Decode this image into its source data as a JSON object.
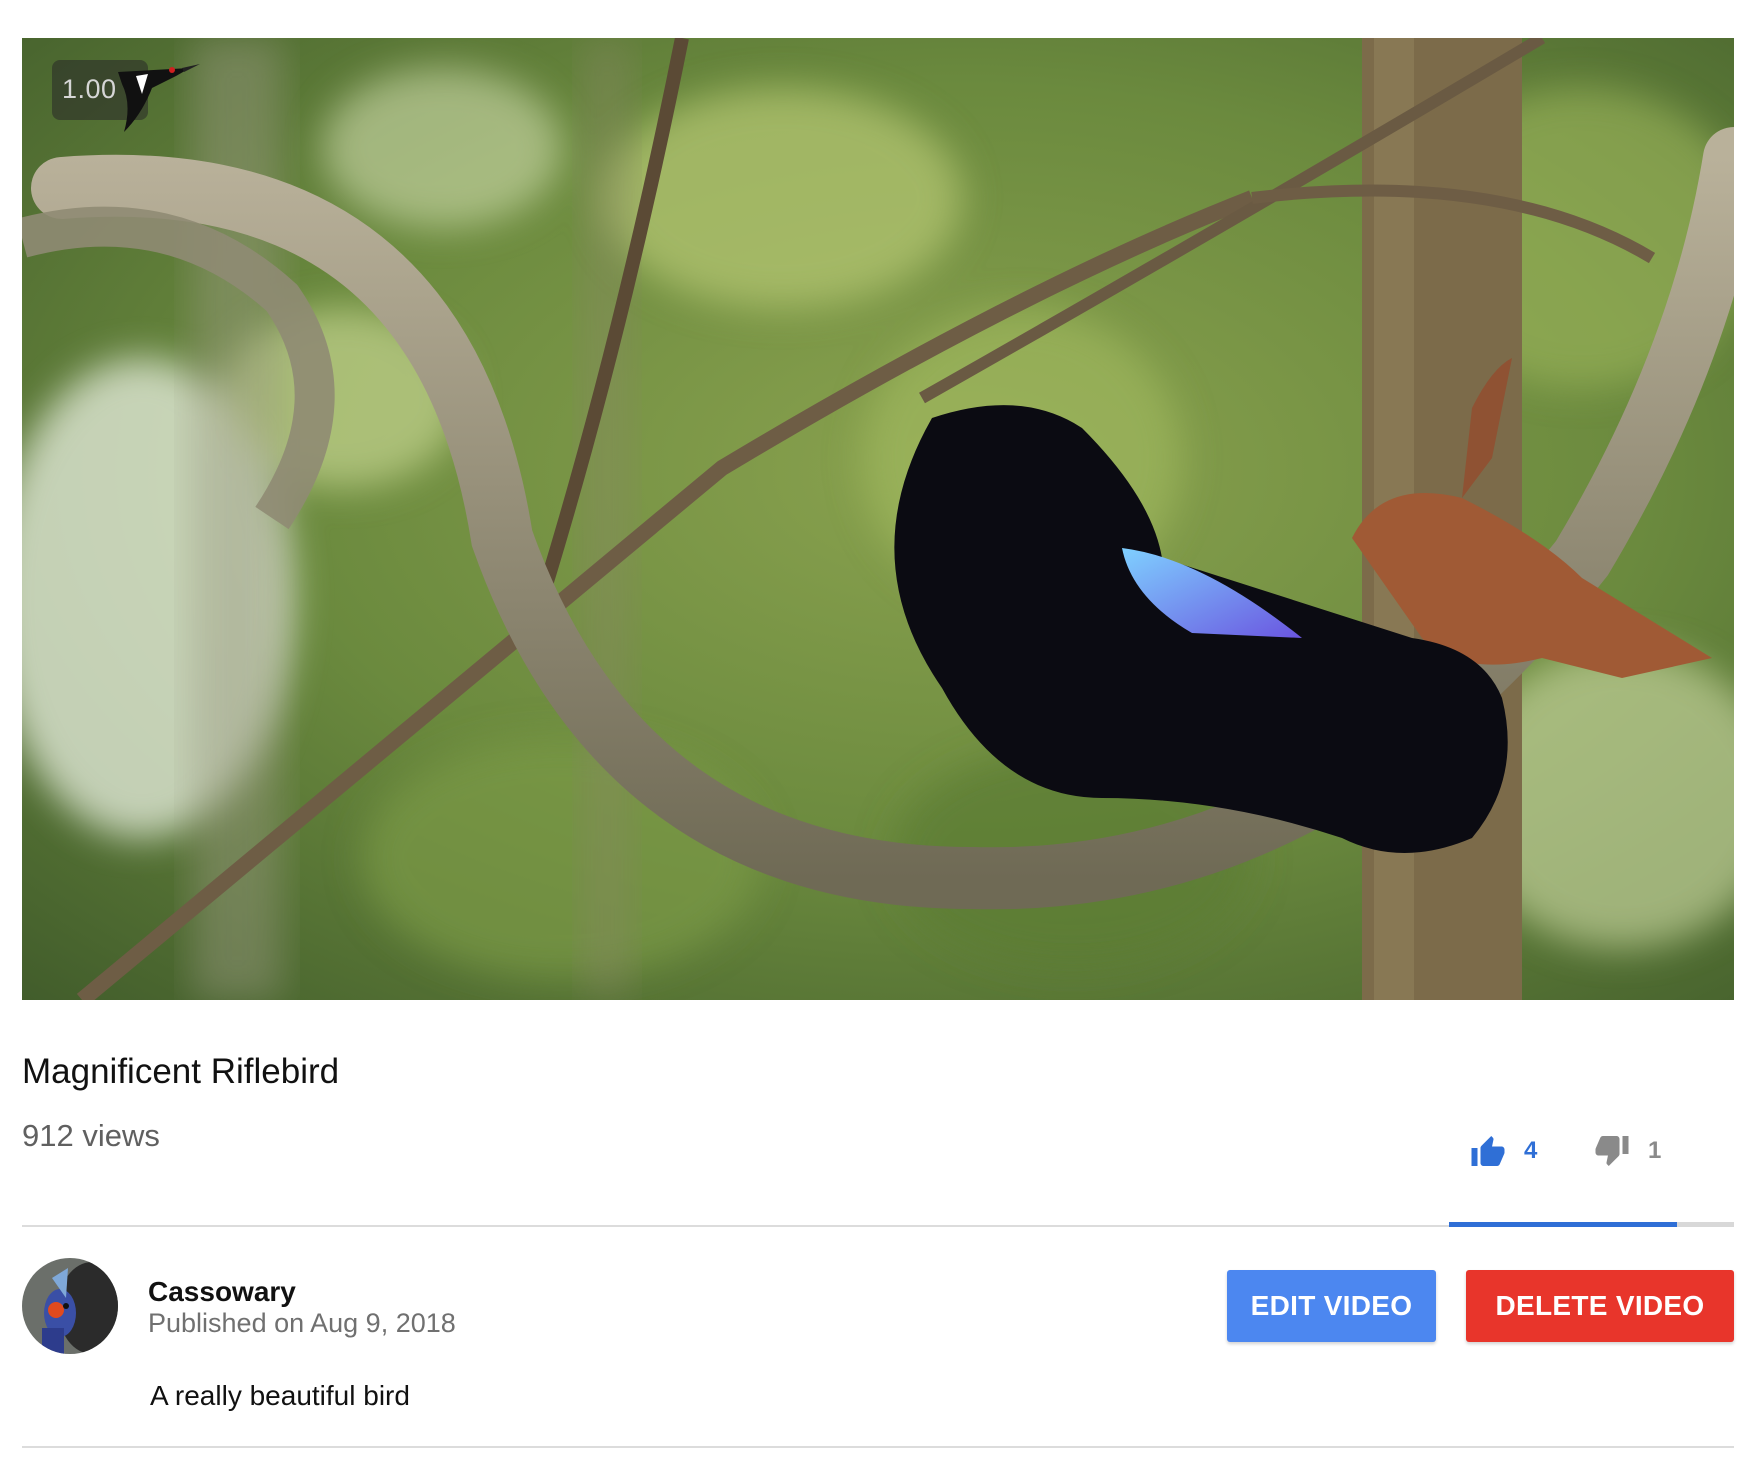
{
  "video": {
    "title": "Magnificent Riflebird",
    "views": "912 views",
    "playback_speed": "1.00"
  },
  "ratings": {
    "likes": "4",
    "dislikes": "1",
    "like_fraction": 0.8
  },
  "channel": {
    "name": "Cassowary",
    "published": "Published on Aug 9, 2018"
  },
  "description": "A really beautiful bird",
  "actions": {
    "edit_label": "EDIT VIDEO",
    "delete_label": "DELETE VIDEO"
  },
  "icons": {
    "like": "thumb-up-icon",
    "dislike": "thumb-down-icon",
    "speed_logo": "bird-logo-icon"
  },
  "colors": {
    "like_accent": "#2f6fd6",
    "edit_button": "#4c87f0",
    "delete_button": "#e8352b"
  }
}
